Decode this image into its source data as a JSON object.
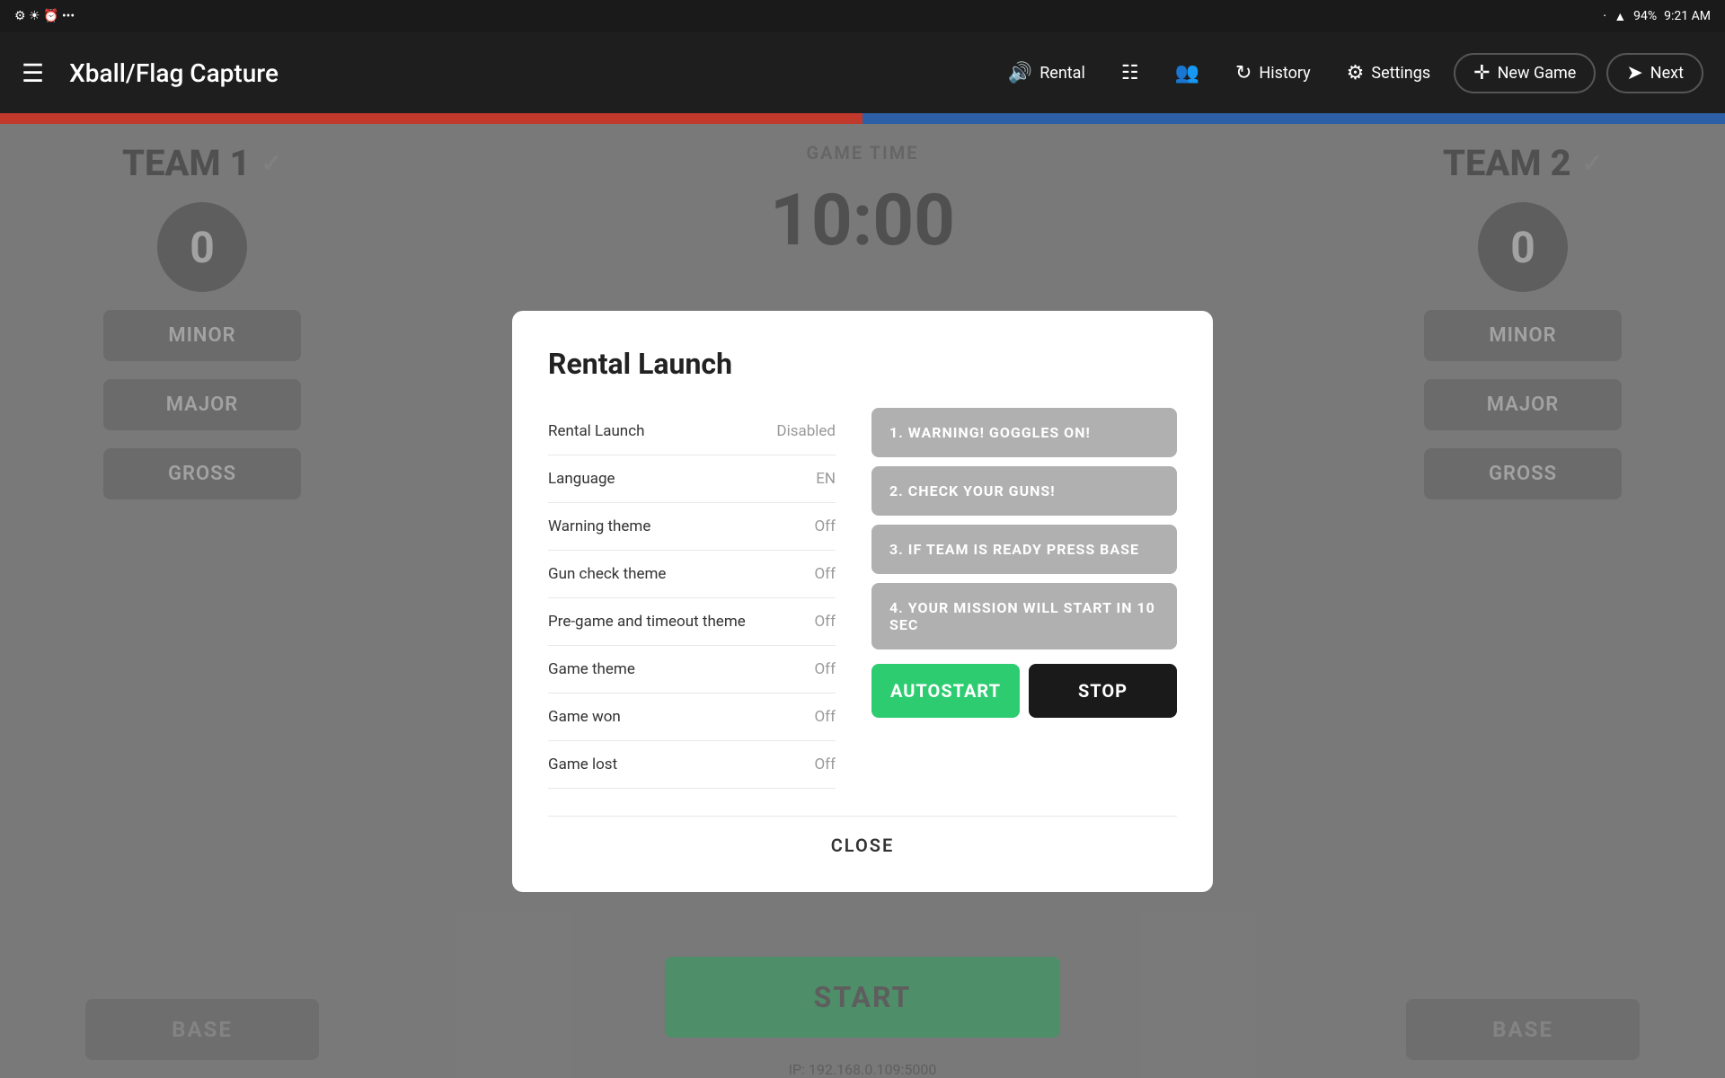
{
  "statusBar": {
    "icons": [
      "bluetooth",
      "wifi",
      "battery",
      "time"
    ],
    "batteryLevel": "94%",
    "time": "9:21 AM"
  },
  "nav": {
    "menuIcon": "☰",
    "title": "Xball/Flag Capture",
    "rental": "Rental",
    "history": "History",
    "settings": "Settings",
    "newGame": "New Game",
    "next": "Next"
  },
  "teams": {
    "team1": {
      "name": "TEAM 1",
      "score": "0",
      "minor": "MINOR",
      "major": "MAJOR",
      "gross": "GROSS",
      "base": "BASE"
    },
    "team2": {
      "name": "TEAM 2",
      "score": "0",
      "minor": "MINOR",
      "major": "MAJOR",
      "gross": "GROSS",
      "base": "BASE"
    }
  },
  "gameCenter": {
    "gameTimeLabel": "GAME TIME",
    "gameTimeValue": "10:00",
    "startLabel": "START",
    "ipText": "IP: 192.168.0.109:5000"
  },
  "modal": {
    "title": "Rental Launch",
    "settings": [
      {
        "label": "Rental Launch",
        "value": "Disabled"
      },
      {
        "label": "Language",
        "value": "EN"
      },
      {
        "label": "Warning theme",
        "value": "Off"
      },
      {
        "label": "Gun check theme",
        "value": "Off"
      },
      {
        "label": "Pre-game and timeout theme",
        "value": "Off"
      },
      {
        "label": "Game theme",
        "value": "Off"
      },
      {
        "label": "Game won",
        "value": "Off"
      },
      {
        "label": "Game lost",
        "value": "Off"
      }
    ],
    "announcements": [
      "1. WARNING! GOGGLES ON!",
      "2. CHECK YOUR GUNS!",
      "3. IF TEAM IS READY PRESS BASE",
      "4. YOUR MISSION WILL START IN 10 SEC"
    ],
    "autostartLabel": "AUTOSTART",
    "stopLabel": "STOP",
    "closeLabel": "CLOSE"
  }
}
